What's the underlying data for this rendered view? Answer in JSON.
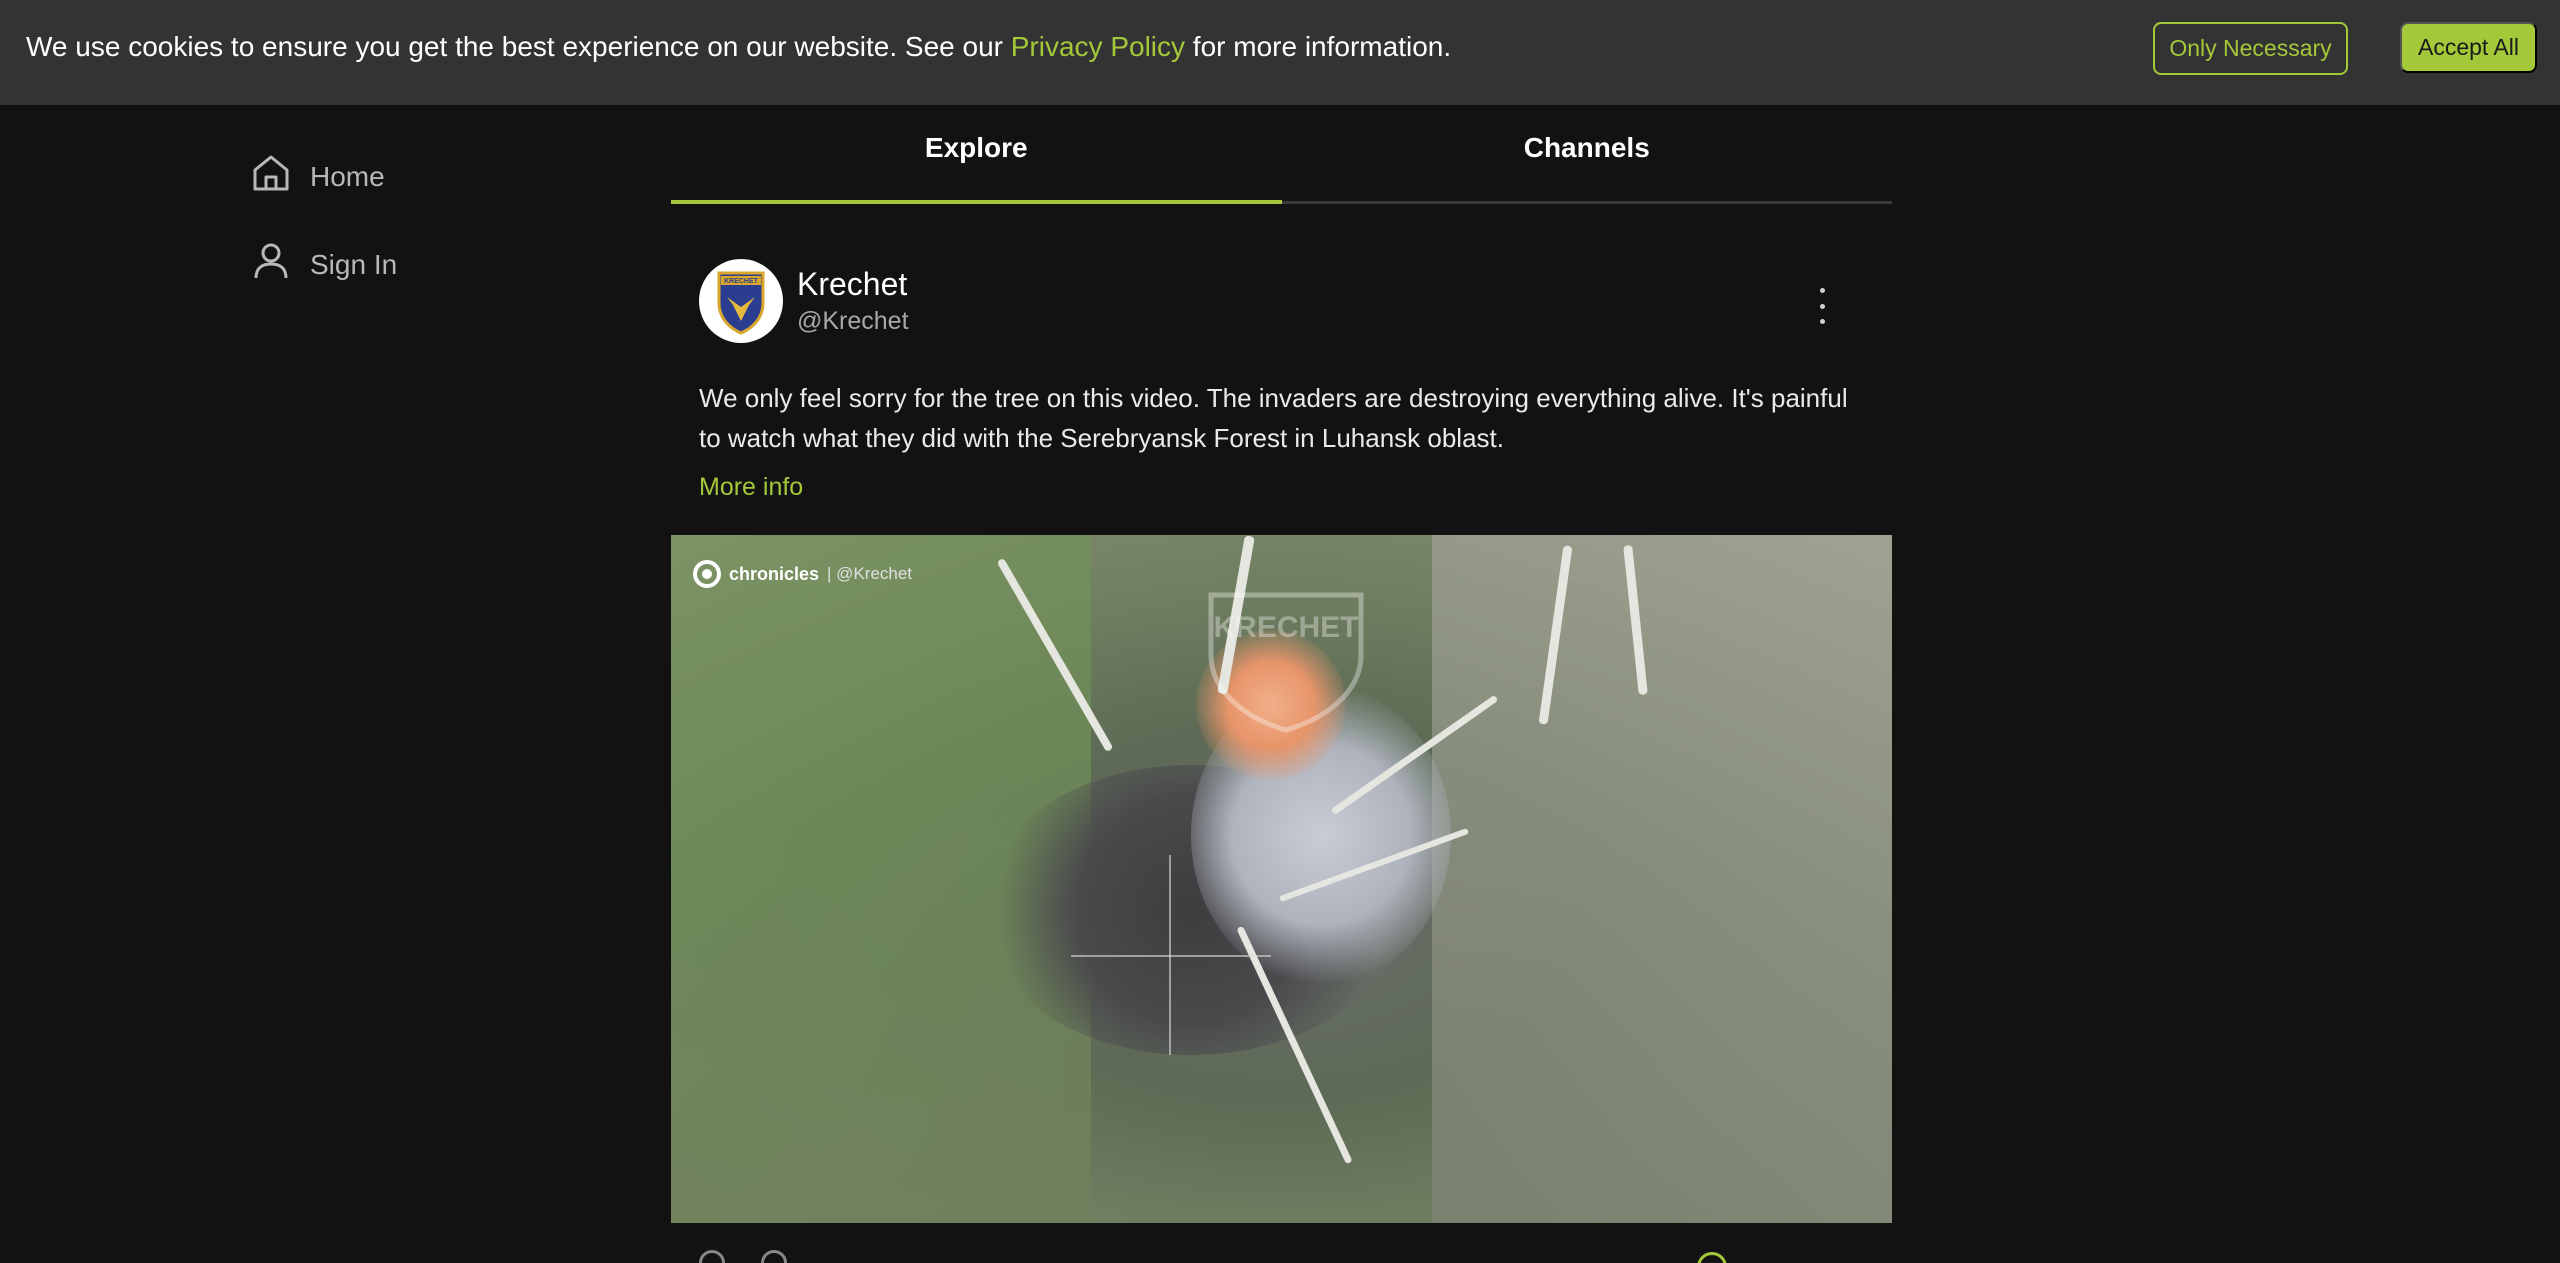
{
  "cookie_banner": {
    "text_before": "We use cookies to ensure you get the best experience on our website. See our ",
    "link_text": "Privacy Policy",
    "text_after": " for more information.",
    "only_necessary_label": "Only Necessary",
    "accept_all_label": "Accept All"
  },
  "sidebar": {
    "items": [
      {
        "label": "Home",
        "icon": "home-icon"
      },
      {
        "label": "Sign In",
        "icon": "user-icon"
      }
    ]
  },
  "tabs": [
    {
      "label": "Explore",
      "active": true
    },
    {
      "label": "Channels",
      "active": false
    }
  ],
  "post": {
    "author_name": "Krechet",
    "author_handle": "@Krechet",
    "avatar_text": "KRECHET",
    "text": "We only feel sorry for the tree on this video. The invaders are destroying everything alive. It's painful to watch what they did with the Serebryansk Forest in Luhansk oblast.",
    "more_info_label": "More info",
    "media": {
      "watermark_brand": "chronicles",
      "watermark_handle": "| @Krechet",
      "overlay_text": "KRECHET"
    }
  },
  "colors": {
    "accent": "#a3c93a",
    "background": "#121212",
    "banner": "#333333"
  }
}
